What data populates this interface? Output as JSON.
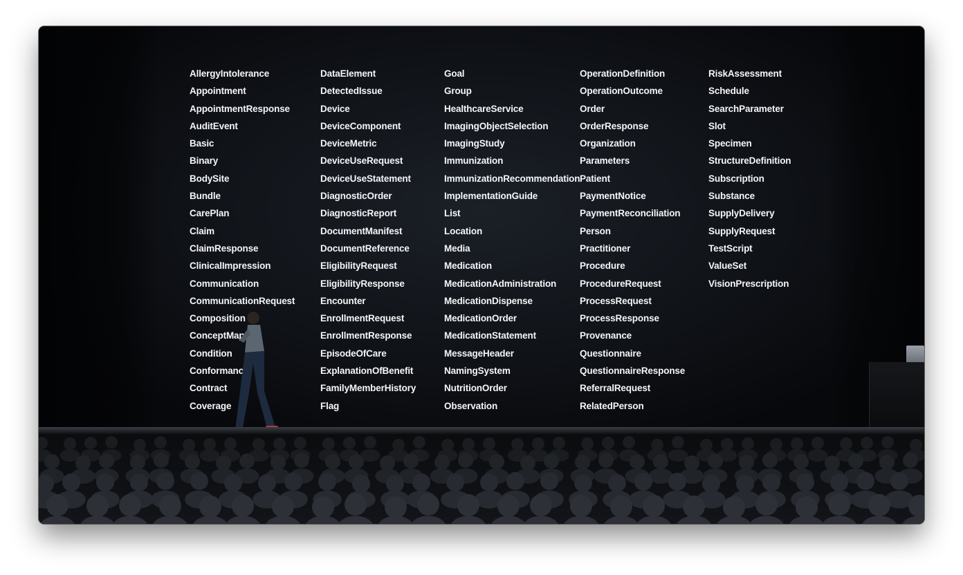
{
  "slide": {
    "columns": [
      [
        "AllergyIntolerance",
        "Appointment",
        "AppointmentResponse",
        "AuditEvent",
        "Basic",
        "Binary",
        "BodySite",
        "Bundle",
        "CarePlan",
        "Claim",
        "ClaimResponse",
        "ClinicalImpression",
        "Communication",
        "CommunicationRequest",
        "Composition",
        "ConceptMap",
        "Condition",
        "Conformance",
        "Contract",
        "Coverage"
      ],
      [
        "DataElement",
        "DetectedIssue",
        "Device",
        "DeviceComponent",
        "DeviceMetric",
        "DeviceUseRequest",
        "DeviceUseStatement",
        "DiagnosticOrder",
        "DiagnosticReport",
        "DocumentManifest",
        "DocumentReference",
        "EligibilityRequest",
        "EligibilityResponse",
        "Encounter",
        "EnrollmentRequest",
        "EnrollmentResponse",
        "EpisodeOfCare",
        "ExplanationOfBenefit",
        "FamilyMemberHistory",
        "Flag"
      ],
      [
        "Goal",
        "Group",
        "HealthcareService",
        "ImagingObjectSelection",
        "ImagingStudy",
        "Immunization",
        "ImmunizationRecommendation",
        "ImplementationGuide",
        "List",
        "Location",
        "Media",
        "Medication",
        "MedicationAdministration",
        "MedicationDispense",
        "MedicationOrder",
        "MedicationStatement",
        "MessageHeader",
        "NamingSystem",
        "NutritionOrder",
        "Observation"
      ],
      [
        "OperationDefinition",
        "OperationOutcome",
        "Order",
        "OrderResponse",
        "Organization",
        "Parameters",
        "Patient",
        "PaymentNotice",
        "PaymentReconciliation",
        "Person",
        "Practitioner",
        "Procedure",
        "ProcedureRequest",
        "ProcessRequest",
        "ProcessResponse",
        "Provenance",
        "Questionnaire",
        "QuestionnaireResponse",
        "ReferralRequest",
        "RelatedPerson"
      ],
      [
        "RiskAssessment",
        "Schedule",
        "SearchParameter",
        "Slot",
        "Specimen",
        "StructureDefinition",
        "Subscription",
        "Substance",
        "SupplyDelivery",
        "SupplyRequest",
        "TestScript",
        "ValueSet",
        "VisionPrescription"
      ]
    ]
  },
  "colors": {
    "text": "#f4f6f8",
    "screen": "#101318",
    "stage": "#050608"
  }
}
